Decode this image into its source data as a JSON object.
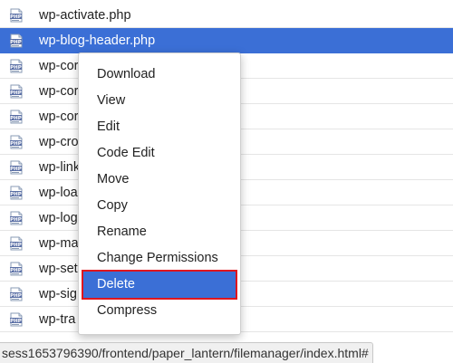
{
  "file_list": {
    "rows": [
      {
        "icon": "php-file-icon",
        "name": "wp-activate.php",
        "selected": false
      },
      {
        "icon": "php-file-icon",
        "name": "wp-blog-header.php",
        "selected": true
      },
      {
        "icon": "php-file-icon",
        "name": "wp-cor",
        "selected": false
      },
      {
        "icon": "php-file-icon",
        "name": "wp-cor",
        "selected": false
      },
      {
        "icon": "php-file-icon",
        "name": "wp-cor",
        "selected": false
      },
      {
        "icon": "php-file-icon",
        "name": "wp-cro",
        "selected": false
      },
      {
        "icon": "php-file-icon",
        "name": "wp-link",
        "selected": false
      },
      {
        "icon": "php-file-icon",
        "name": "wp-loa",
        "selected": false
      },
      {
        "icon": "php-file-icon",
        "name": "wp-log",
        "selected": false
      },
      {
        "icon": "php-file-icon",
        "name": "wp-ma",
        "selected": false
      },
      {
        "icon": "php-file-icon",
        "name": "wp-set",
        "selected": false
      },
      {
        "icon": "php-file-icon",
        "name": "wp-sig",
        "selected": false
      },
      {
        "icon": "php-file-icon",
        "name": "wp-tra",
        "selected": false
      }
    ]
  },
  "context_menu": {
    "items": [
      {
        "label": "Download",
        "name": "download",
        "highlighted": false
      },
      {
        "label": "View",
        "name": "view",
        "highlighted": false
      },
      {
        "label": "Edit",
        "name": "edit",
        "highlighted": false
      },
      {
        "label": "Code Edit",
        "name": "code-edit",
        "highlighted": false
      },
      {
        "label": "Move",
        "name": "move",
        "highlighted": false
      },
      {
        "label": "Copy",
        "name": "copy",
        "highlighted": false
      },
      {
        "label": "Rename",
        "name": "rename",
        "highlighted": false
      },
      {
        "label": "Change Permissions",
        "name": "change-permissions",
        "highlighted": false
      },
      {
        "label": "Delete",
        "name": "delete",
        "highlighted": true
      },
      {
        "label": "Compress",
        "name": "compress",
        "highlighted": false
      }
    ]
  },
  "status_bar": {
    "url": "sess1653796390/frontend/paper_lantern/filemanager/index.html#"
  },
  "colors": {
    "selection": "#3b6fd6",
    "highlight_border": "#e0161e"
  }
}
